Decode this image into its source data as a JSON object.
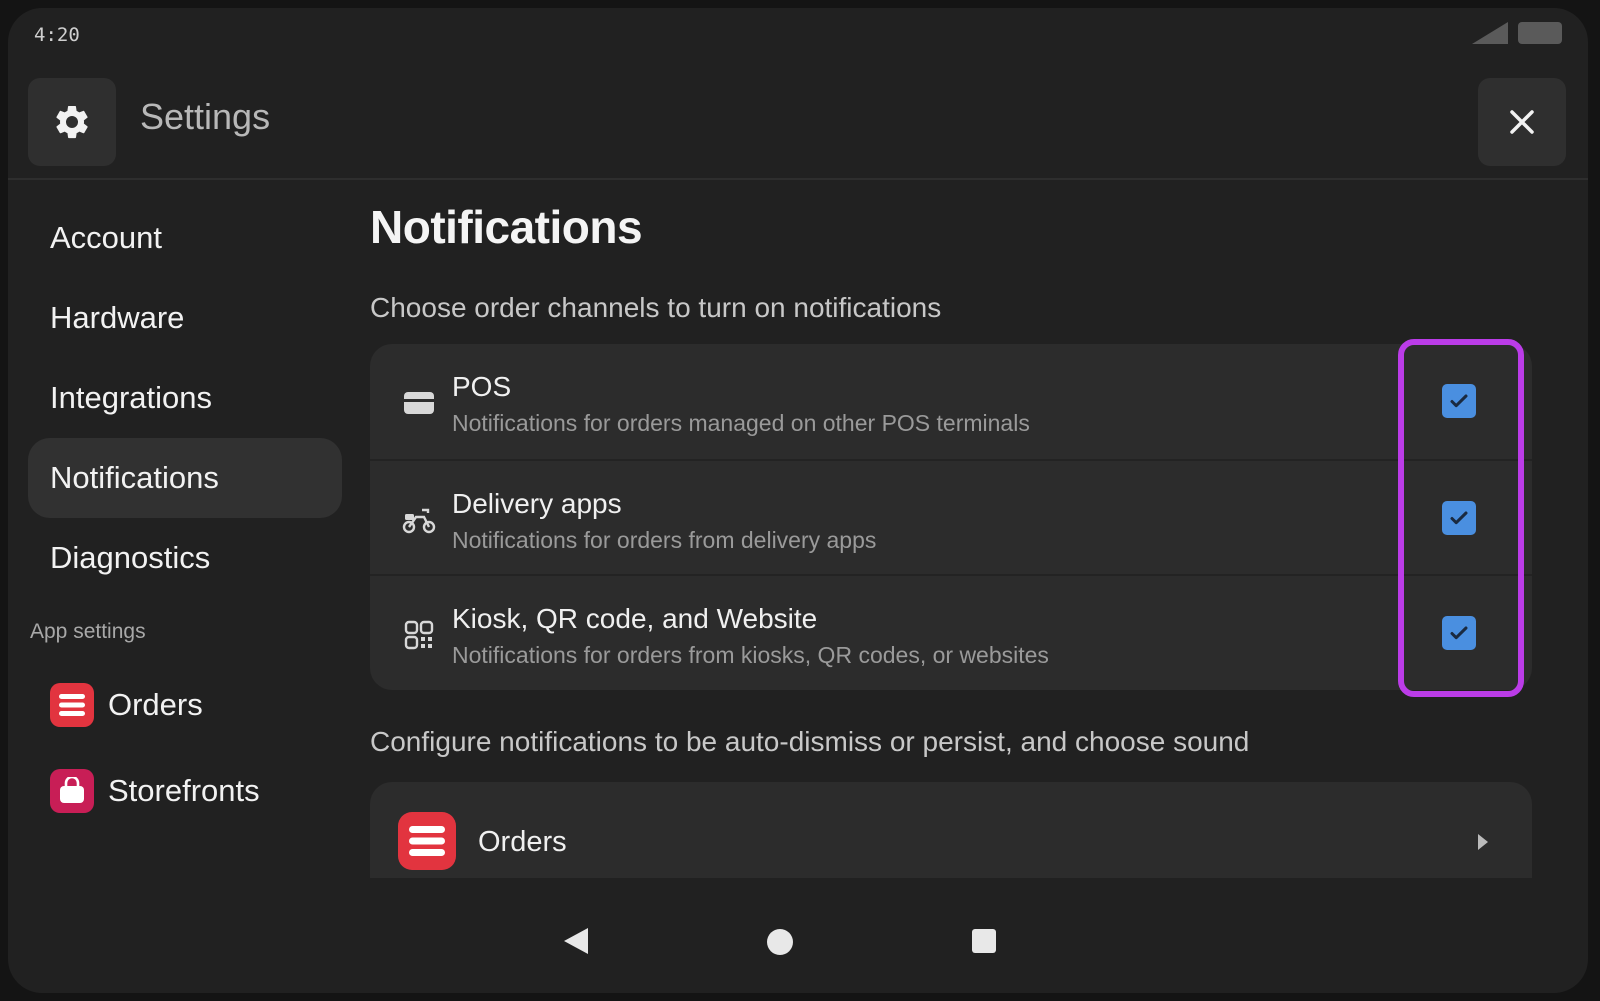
{
  "status": {
    "time": "4:20"
  },
  "header": {
    "title": "Settings",
    "gear_icon": "gear-icon",
    "close_icon": "close-icon"
  },
  "sidebar": {
    "items": [
      {
        "label": "Account"
      },
      {
        "label": "Hardware"
      },
      {
        "label": "Integrations"
      },
      {
        "label": "Notifications",
        "active": true
      },
      {
        "label": "Diagnostics"
      }
    ],
    "section_label": "App settings",
    "apps": [
      {
        "label": "Orders",
        "color": "#e2343f",
        "icon": "orders-icon"
      },
      {
        "label": "Storefronts",
        "color": "#c81e56",
        "icon": "storefronts-icon"
      }
    ]
  },
  "main": {
    "title": "Notifications",
    "subtitle": "Choose order channels to turn on notifications",
    "channels": [
      {
        "name": "POS",
        "description": "Notifications for orders managed on other POS terminals",
        "checked": true,
        "icon": "pos-terminal-icon"
      },
      {
        "name": "Delivery apps",
        "description": "Notifications for orders from delivery apps",
        "checked": true,
        "icon": "scooter-icon"
      },
      {
        "name": "Kiosk, QR code, and Website",
        "description": "Notifications for orders from kiosks, QR codes, or websites",
        "checked": true,
        "icon": "qr-code-icon"
      }
    ],
    "configure_text": "Configure notifications to be auto-dismiss or persist, and choose sound",
    "orders_card": {
      "label": "Orders",
      "icon": "orders-icon"
    }
  },
  "colors": {
    "checkbox": "#4a8fe0",
    "highlight": "#bb3ce8",
    "background": "#212121"
  }
}
